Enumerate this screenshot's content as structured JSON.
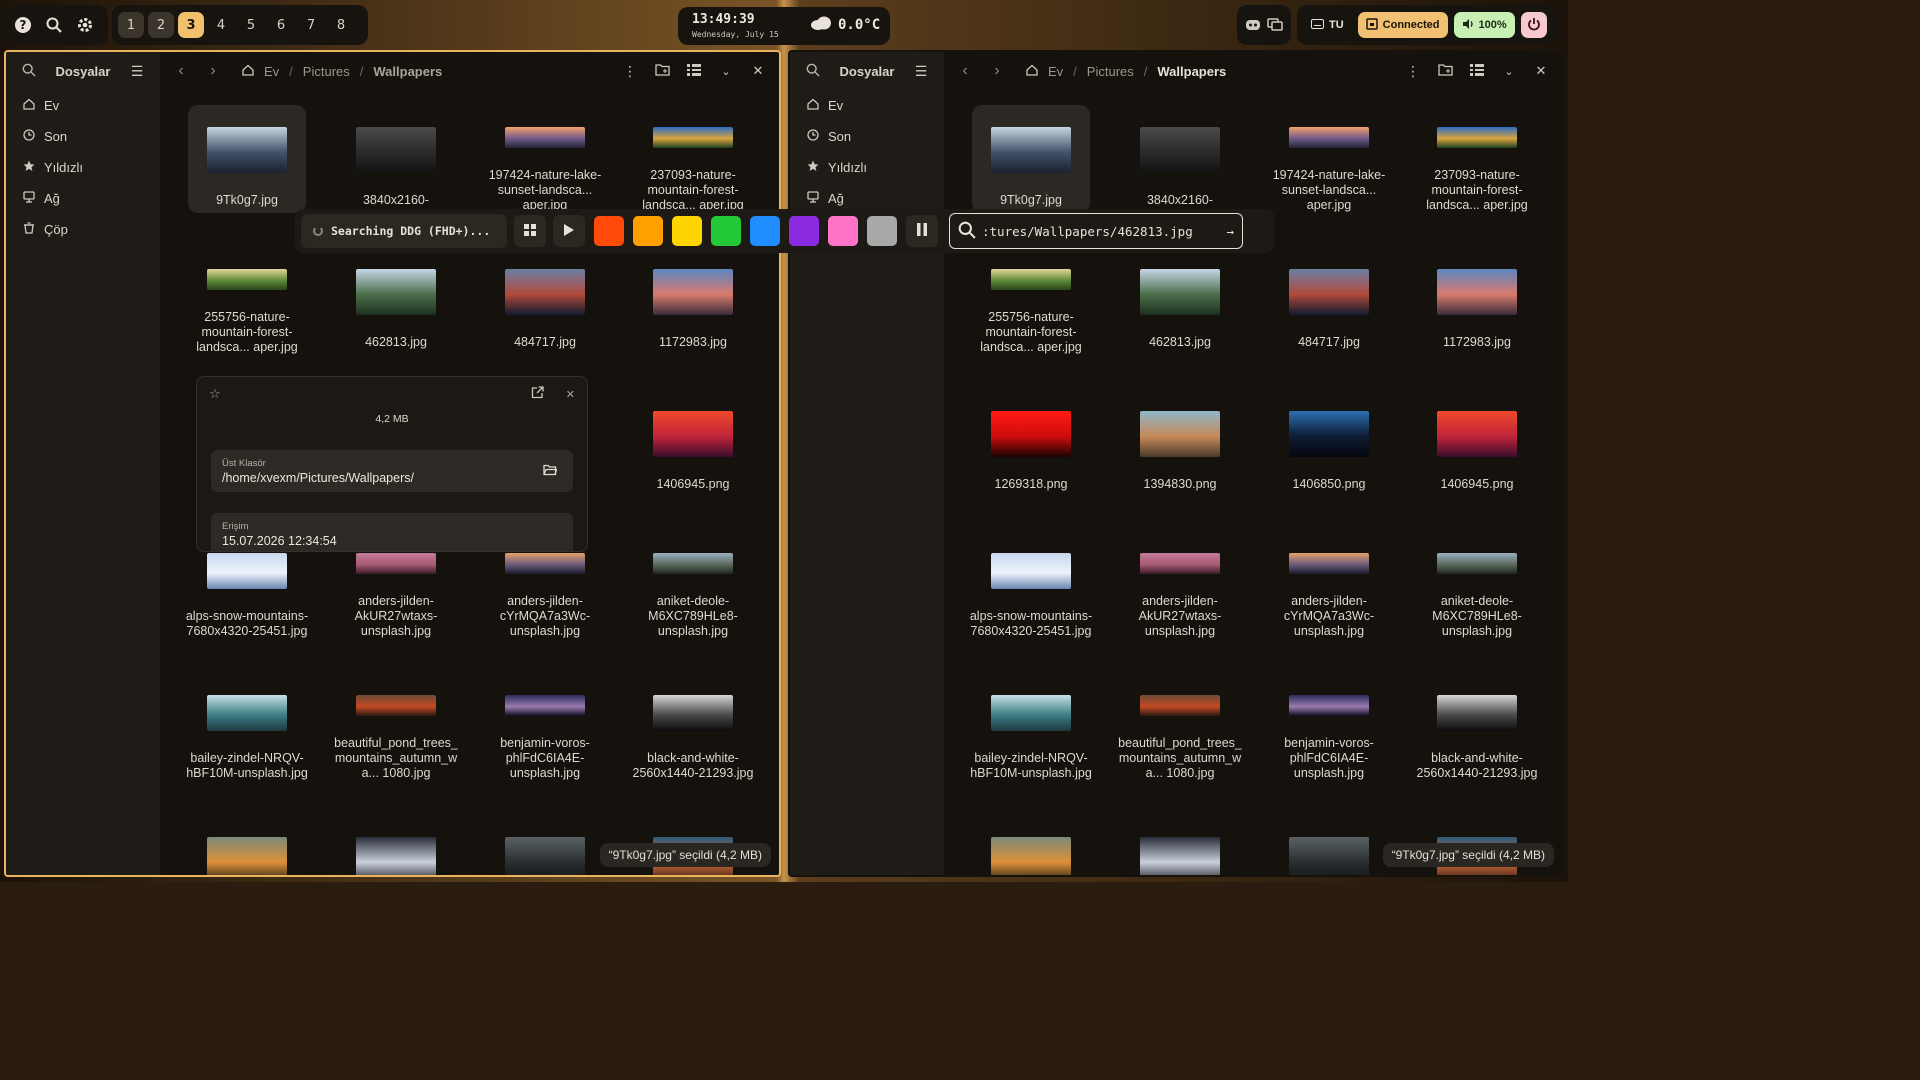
{
  "topbar": {
    "workspaces": [
      {
        "label": "1",
        "state": "occupied"
      },
      {
        "label": "2",
        "state": "occupied"
      },
      {
        "label": "3",
        "state": "active"
      },
      {
        "label": "4",
        "state": "empty"
      },
      {
        "label": "5",
        "state": "empty"
      },
      {
        "label": "6",
        "state": "empty"
      },
      {
        "label": "7",
        "state": "empty"
      },
      {
        "label": "8",
        "state": "empty"
      }
    ],
    "clock_time": "13:49:39",
    "clock_date": "Wednesday, July 15",
    "weather_temp": "0.0°C",
    "language": "TU",
    "network_label": "Connected",
    "volume_label": "100%"
  },
  "accent_color": "#e9b45e",
  "sidebar": {
    "title": "Dosyalar",
    "items": [
      {
        "label": "Ev",
        "icon": "home-icon"
      },
      {
        "label": "Son",
        "icon": "clock-icon"
      },
      {
        "label": "Yıldızlı",
        "icon": "star-icon"
      },
      {
        "label": "Ağ",
        "icon": "network-icon"
      },
      {
        "label": "Çöp",
        "icon": "trash-icon"
      }
    ]
  },
  "breadcrumb": [
    "Ev",
    "Pictures",
    "Wallpapers"
  ],
  "files": [
    {
      "name": "9Tk0g7.jpg",
      "colors": [
        "#c9d6e3",
        "#41526a",
        "#1b2230"
      ]
    },
    {
      "name": "3840x2160-",
      "colors": [
        "#4a4a4a",
        "#2b2b2b",
        "#111111"
      ]
    },
    {
      "name": "197424-nature-lake-sunset-landsca... aper.jpg",
      "colors": [
        "#f3a16b",
        "#6e5a8a",
        "#22243a"
      ]
    },
    {
      "name": "237093-nature-mountain-forest-landsca... aper.jpg",
      "colors": [
        "#2b6cc4",
        "#d9a43c",
        "#1d3f22"
      ]
    },
    {
      "name": "255756-nature-mountain-forest-landsca... aper.jpg",
      "colors": [
        "#e3d89a",
        "#5e8a3a",
        "#2a4418"
      ]
    },
    {
      "name": "462813.jpg",
      "colors": [
        "#c7d7e6",
        "#4b6e4b",
        "#1e3020"
      ]
    },
    {
      "name": "484717.jpg",
      "colors": [
        "#6d7fa5",
        "#b04a3c",
        "#101a2e"
      ]
    },
    {
      "name": "1172983.jpg",
      "colors": [
        "#5b86c2",
        "#d97c6e",
        "#3a2a3a"
      ]
    },
    {
      "name": "1269318.png",
      "colors": [
        "#ff1a14",
        "#d00c0c",
        "#1a0404"
      ]
    },
    {
      "name": "1394830.png",
      "colors": [
        "#8fb7c9",
        "#c78a5a",
        "#4a3a2a"
      ]
    },
    {
      "name": "1406850.png",
      "colors": [
        "#2c6fb0",
        "#0e1c34",
        "#05070e"
      ]
    },
    {
      "name": "1406945.png",
      "colors": [
        "#f04a2a",
        "#c2243c",
        "#3a0c2a"
      ]
    },
    {
      "name": "alps-snow-mountains-7680x4320-25451.jpg",
      "colors": [
        "#c7d8ee",
        "#eef3fa",
        "#6b86b4"
      ]
    },
    {
      "name": "anders-jilden-AkUR27wtaxs-unsplash.jpg",
      "colors": [
        "#c57b9c",
        "#a85a74",
        "#3a1c2a"
      ]
    },
    {
      "name": "anders-jilden-cYrMQA7a3Wc-unsplash.jpg",
      "colors": [
        "#e6a069",
        "#6b5a7a",
        "#1a1c2e"
      ]
    },
    {
      "name": "aniket-deole-M6XC789HLe8-unsplash.jpg",
      "colors": [
        "#9ab0c2",
        "#5b6a5a",
        "#1e2620"
      ]
    },
    {
      "name": "bailey-zindel-NRQV-hBF10M-unsplash.jpg",
      "colors": [
        "#c9dfe6",
        "#3d7f86",
        "#1a3a3e"
      ]
    },
    {
      "name": "beautiful_pond_trees_mountains_autumn_wa... 1080.jpg",
      "colors": [
        "#6b4a36",
        "#c24a24",
        "#2a1a12"
      ]
    },
    {
      "name": "benjamin-voros-phlFdC6IA4E-unsplash.jpg",
      "colors": [
        "#2c2e5a",
        "#9a7bb0",
        "#0e0e1e"
      ]
    },
    {
      "name": "black-and-white-2560x1440-21293.jpg",
      "colors": [
        "#d6d6d6",
        "#4a4a4a",
        "#0c0c0c"
      ]
    },
    {
      "name": "",
      "colors": [
        "#7a8a7a",
        "#e0903a",
        "#1a1a14"
      ]
    },
    {
      "name": "",
      "colors": [
        "#2a2e3a",
        "#c9cfdc",
        "#1a1c24"
      ]
    },
    {
      "name": "",
      "colors": [
        "#5a6266",
        "#2a2e30",
        "#121416"
      ]
    },
    {
      "name": "",
      "colors": [
        "#2f5a78",
        "#d46a3a",
        "#2a1812"
      ]
    }
  ],
  "left_selected_first_file_only": true,
  "status": "“9Tk0g7.jpg” seçildi (4,2 MB)",
  "wallpaper_toolbar": {
    "search_status": "Searching DDG (FHD+)...",
    "swatches": [
      "#ff4a0a",
      "#ffa000",
      "#ffd400",
      "#24c93a",
      "#1f8cff",
      "#8a2be2",
      "#ff74c6",
      "#a9a9a9"
    ],
    "url_value": ":tures/Wallpapers/462813.jpg"
  },
  "properties_popup": {
    "size": "4,2 MB",
    "parent_label": "Üst Klasör",
    "parent_value": "/home/xvexm/Pictures/Wallpapers/",
    "access_label": "Erişim",
    "access_value": "15.07.2026 12:34:54"
  }
}
